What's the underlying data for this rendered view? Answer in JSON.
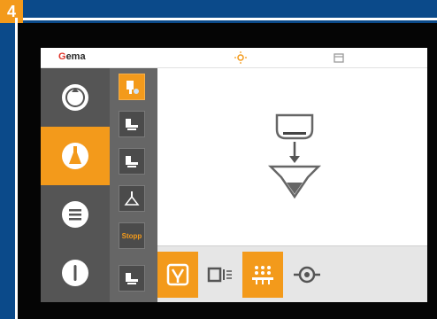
{
  "step": {
    "number": "4"
  },
  "header": {
    "logo_text": "Gema",
    "icons": [
      "sun-icon",
      "box-icon"
    ]
  },
  "sidebar": {
    "items": [
      {
        "icon": "recycle-icon",
        "active": false
      },
      {
        "icon": "spray-gun-icon",
        "active": true
      },
      {
        "icon": "list-icon",
        "active": false
      },
      {
        "icon": "power-icon",
        "active": false
      }
    ]
  },
  "subbar": {
    "items": [
      {
        "icon": "gun-settings-icon",
        "active": true
      },
      {
        "icon": "gun-icon",
        "active": false
      },
      {
        "icon": "gun-icon",
        "active": false
      },
      {
        "icon": "nozzle-icon",
        "active": false
      },
      {
        "label": "Stopp",
        "active": false
      },
      {
        "icon": "gun-icon",
        "active": false
      }
    ]
  },
  "main": {
    "diagram": "hopper-to-pump-diagram"
  },
  "bottombar": {
    "items": [
      {
        "icon": "powder-pump-icon",
        "active": true
      },
      {
        "icon": "sieve-icon",
        "active": false
      },
      {
        "icon": "fluidizing-icon",
        "active": true
      },
      {
        "icon": "pump-valve-icon",
        "active": false
      }
    ]
  },
  "colors": {
    "accent": "#f39a1b",
    "frame": "#0b4a8a",
    "sidebar": "#555555"
  }
}
